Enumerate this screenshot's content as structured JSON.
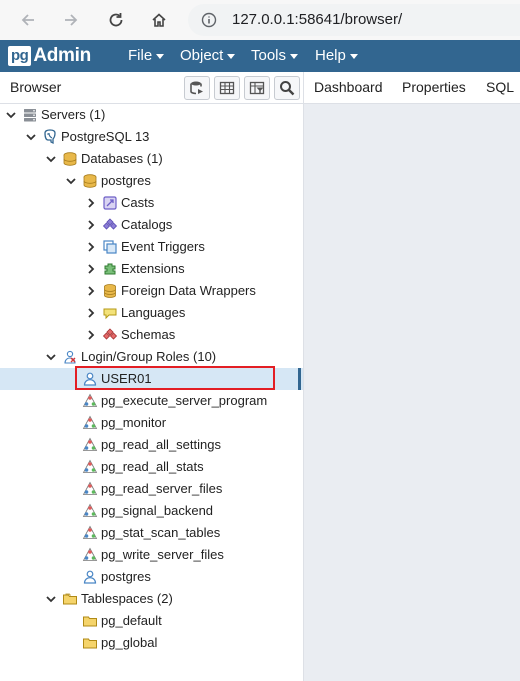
{
  "browser": {
    "url": "127.0.0.1:58641/browser/"
  },
  "app": {
    "logo_pg": "pg",
    "logo_admin": "Admin",
    "menus": [
      {
        "label": "File"
      },
      {
        "label": "Object"
      },
      {
        "label": "Tools"
      },
      {
        "label": "Help"
      }
    ]
  },
  "panel": {
    "title": "Browser",
    "tools": [
      "query-tool-icon",
      "view-data-icon",
      "filtered-rows-icon",
      "search-objects-icon"
    ]
  },
  "tabs": [
    {
      "label": "Dashboard"
    },
    {
      "label": "Properties"
    },
    {
      "label": "SQL"
    }
  ],
  "tree": {
    "servers": "Servers (1)",
    "server": "PostgreSQL 13",
    "databases": "Databases (1)",
    "database": "postgres",
    "db_children": [
      {
        "label": "Casts",
        "icon": "casts-icon"
      },
      {
        "label": "Catalogs",
        "icon": "catalogs-icon"
      },
      {
        "label": "Event Triggers",
        "icon": "event-triggers-icon"
      },
      {
        "label": "Extensions",
        "icon": "extensions-icon"
      },
      {
        "label": "Foreign Data Wrappers",
        "icon": "foreign-data-wrappers-icon"
      },
      {
        "label": "Languages",
        "icon": "languages-icon"
      },
      {
        "label": "Schemas",
        "icon": "schemas-icon"
      }
    ],
    "roles_group": "Login/Group Roles (10)",
    "roles": [
      {
        "label": "USER01",
        "icon": "login-role-icon",
        "selected": true
      },
      {
        "label": "pg_execute_server_program",
        "icon": "group-role-icon"
      },
      {
        "label": "pg_monitor",
        "icon": "group-role-icon"
      },
      {
        "label": "pg_read_all_settings",
        "icon": "group-role-icon"
      },
      {
        "label": "pg_read_all_stats",
        "icon": "group-role-icon"
      },
      {
        "label": "pg_read_server_files",
        "icon": "group-role-icon"
      },
      {
        "label": "pg_signal_backend",
        "icon": "group-role-icon"
      },
      {
        "label": "pg_stat_scan_tables",
        "icon": "group-role-icon"
      },
      {
        "label": "pg_write_server_files",
        "icon": "group-role-icon"
      },
      {
        "label": "postgres",
        "icon": "login-role-icon"
      }
    ],
    "tablespaces": "Tablespaces (2)",
    "tablespace_items": [
      {
        "label": "pg_default",
        "icon": "tablespace-icon"
      },
      {
        "label": "pg_global",
        "icon": "tablespace-icon"
      }
    ]
  },
  "colors": {
    "navbar": "#326690",
    "selection": "#d6e7f5",
    "highlight_box": "#e31e24"
  }
}
